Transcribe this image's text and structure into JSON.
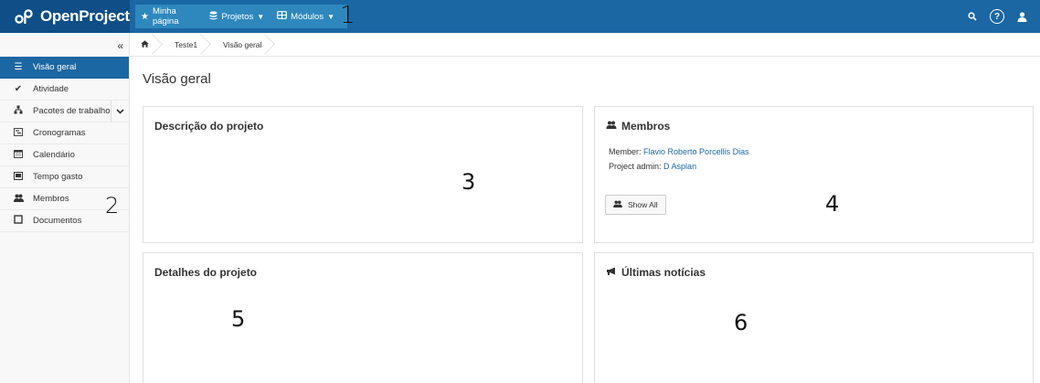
{
  "brand": {
    "name": "OpenProject"
  },
  "topnav": {
    "items": [
      {
        "label": "Minha página",
        "icon": "star-icon"
      },
      {
        "label": "Projetos",
        "icon": "projects-icon"
      },
      {
        "label": "Módulos",
        "icon": "modules-icon"
      }
    ],
    "marker": "1"
  },
  "top_right": {
    "icons": [
      "search-icon",
      "help-icon",
      "user-icon"
    ],
    "help_glyph": "?"
  },
  "sidebar": {
    "collapse_glyph": "«",
    "items": [
      {
        "label": "Visão geral",
        "icon": "list-icon",
        "active": true
      },
      {
        "label": "Atividade",
        "icon": "checkmark-icon"
      },
      {
        "label": "Pacotes de trabalho",
        "icon": "hierarchy-icon",
        "expandable": true
      },
      {
        "label": "Cronogramas",
        "icon": "timeline-icon"
      },
      {
        "label": "Calendário",
        "icon": "calendar-icon"
      },
      {
        "label": "Tempo gasto",
        "icon": "time-icon"
      },
      {
        "label": "Membros",
        "icon": "group-icon"
      },
      {
        "label": "Documentos",
        "icon": "document-icon"
      }
    ],
    "marker": "2"
  },
  "breadcrumb": {
    "items": [
      {
        "label": "",
        "icon": "home-icon"
      },
      {
        "label": "Teste1"
      },
      {
        "label": "Visão geral"
      }
    ]
  },
  "main": {
    "title": "Visão geral",
    "cards": {
      "description": {
        "title": "Descrição do projeto",
        "marker": "3"
      },
      "members": {
        "title": "Membros",
        "member_label": "Member:",
        "member_name": "Flavio Roberto Porcellis Dias",
        "admin_label": "Project admin:",
        "admin_name": "D Asplan",
        "show_all": "Show All",
        "marker": "4"
      },
      "details": {
        "title": "Detalhes do projeto",
        "marker": "5"
      },
      "news": {
        "title": "Últimas notícias",
        "marker": "6"
      }
    }
  },
  "colors": {
    "topbar": "#1a67a3",
    "brand_bg": "#0f4e86",
    "nav_highlight": "#2e88be",
    "active_item": "#1a67a3",
    "link": "#1a67a3"
  }
}
